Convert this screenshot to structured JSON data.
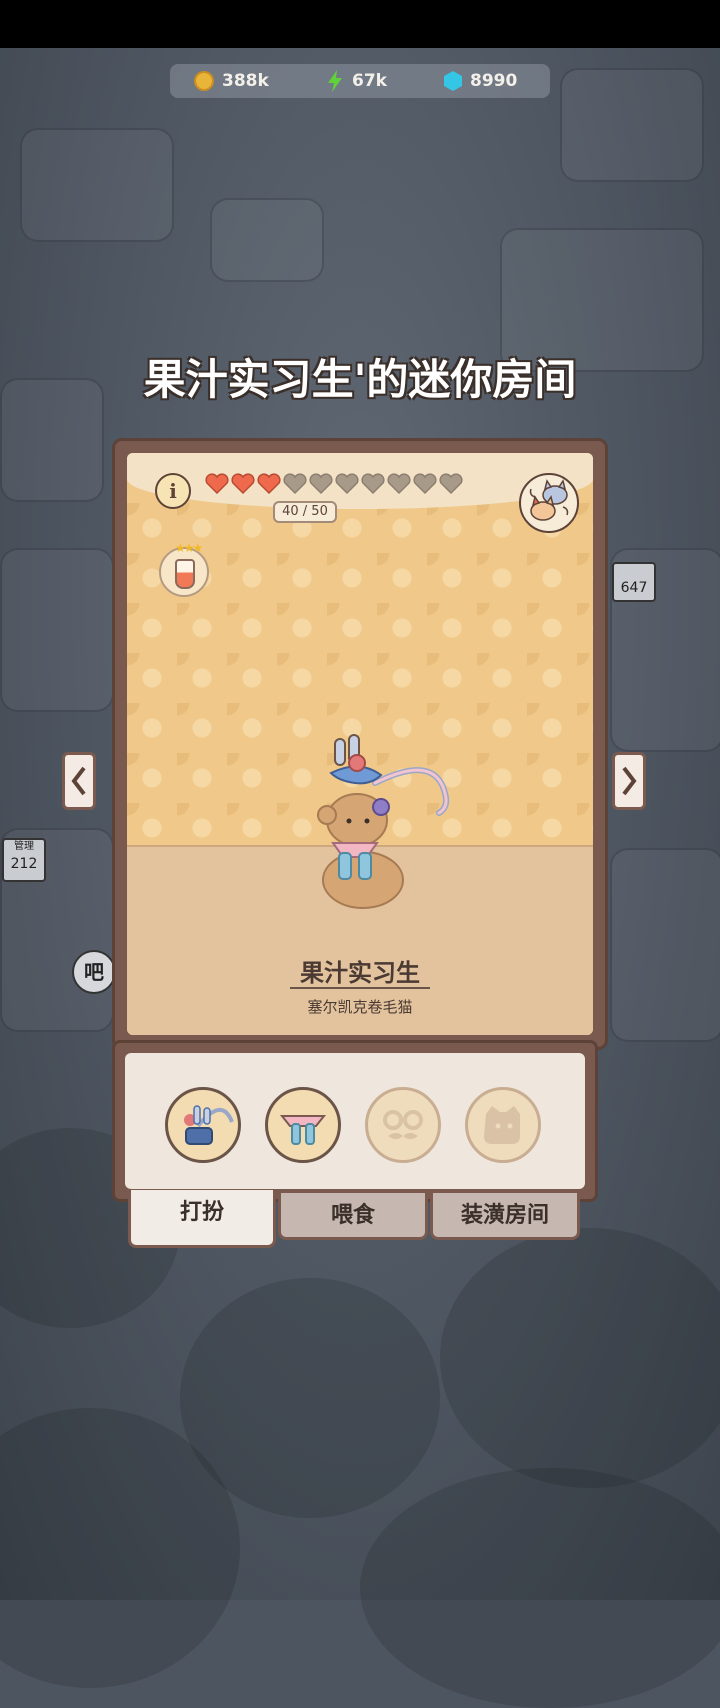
{
  "currencies": {
    "coins": "388k",
    "energy": "67k",
    "gems": "8990"
  },
  "room_title": "果汁实习生'的迷你房间",
  "card": {
    "hearts_filled": 3,
    "hearts_total": 10,
    "affection": "40 / 50",
    "cat_name": "果汁实习生",
    "cat_breed": "塞尔凯克卷毛猫"
  },
  "background_signs": {
    "left_sign": "212",
    "right_sign": "647",
    "left_sign_top": "管理",
    "bubble": "吧"
  },
  "tabs": [
    "打扮",
    "喂食",
    "装潢房间"
  ],
  "colors": {
    "heart_filled": "#ef6a4c",
    "heart_empty": "#a89a88",
    "frame": "#7a5a4e",
    "wall": "#f0c98a"
  }
}
